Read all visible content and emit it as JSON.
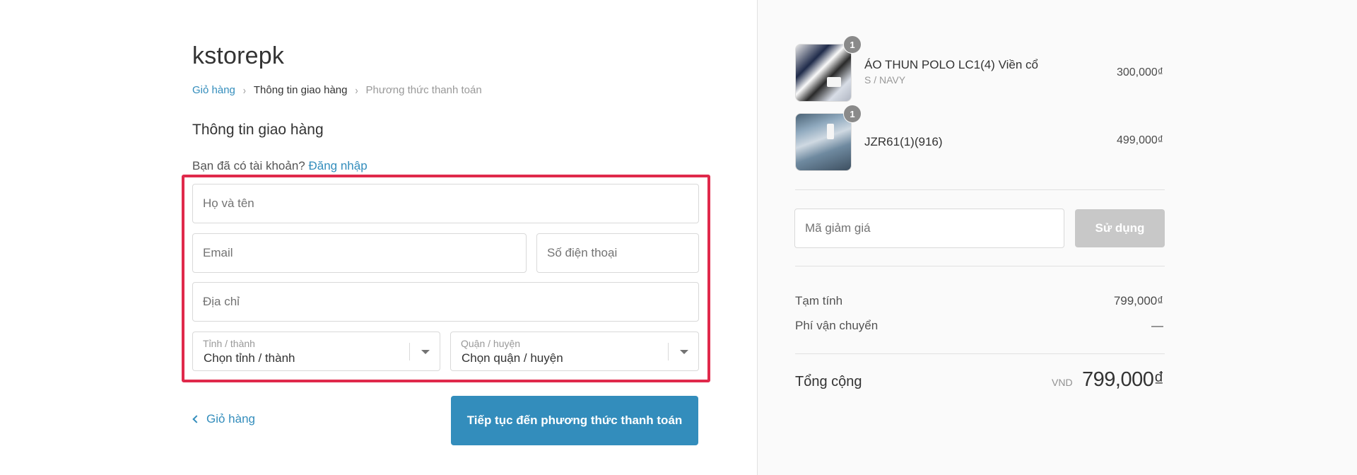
{
  "header": {
    "store_name": "kstorepk"
  },
  "breadcrumb": {
    "items": [
      {
        "label": "Giỏ hàng"
      },
      {
        "label": "Thông tin giao hàng"
      },
      {
        "label": "Phương thức thanh toán"
      }
    ],
    "separator": "›"
  },
  "form": {
    "section_title": "Thông tin giao hàng",
    "account_prompt": "Bạn đã có tài khoản?",
    "login_link": "Đăng nhập",
    "name_placeholder": "Họ và tên",
    "email_placeholder": "Email",
    "phone_placeholder": "Số điện thoại",
    "address_placeholder": "Địa chỉ",
    "province": {
      "label": "Tỉnh / thành",
      "value": "Chọn tỉnh / thành"
    },
    "district": {
      "label": "Quận / huyện",
      "value": "Chọn quận / huyện"
    },
    "back_label": "Giỏ hàng",
    "continue_label": "Tiếp tục đến phương thức thanh toán",
    "highlight_color": "#e0294b"
  },
  "cart": {
    "items": [
      {
        "name": "ÁO THUN POLO LC1(4) Viền cổ",
        "variant": "S / NAVY",
        "price": "300,000₫",
        "quantity": "1"
      },
      {
        "name": "JZR61(1)(916)",
        "variant": "",
        "price": "499,000₫",
        "quantity": "1"
      }
    ]
  },
  "discount": {
    "placeholder": "Mã giảm giá",
    "button_label": "Sử dụng"
  },
  "summary": {
    "subtotal_label": "Tạm tính",
    "subtotal_value": "799,000₫",
    "shipping_label": "Phí vận chuyển",
    "shipping_value": "—",
    "total_label": "Tổng cộng",
    "currency": "VND",
    "total_value": "799,000₫"
  },
  "colors": {
    "accent": "#338dbc",
    "sidebar_bg": "#fafafa",
    "disabled_button": "#c8c8c8"
  }
}
